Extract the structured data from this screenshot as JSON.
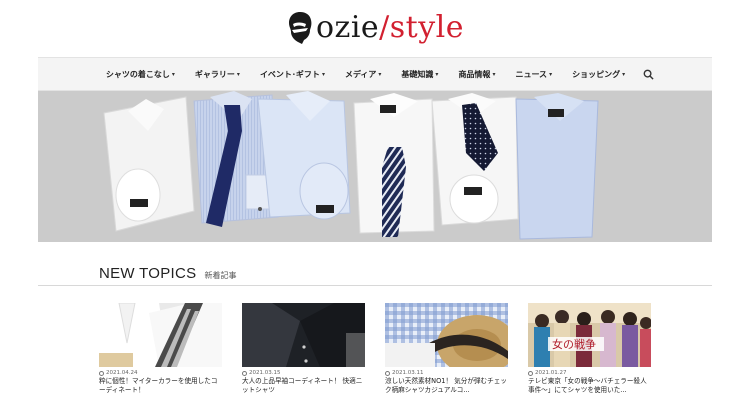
{
  "logo": {
    "part1": "ozie",
    "slash": "/",
    "part2": "style",
    "brand_color": "#d22030"
  },
  "nav": {
    "items": [
      {
        "label": "シャツの着こなし",
        "caret": "▾"
      },
      {
        "label": "ギャラリー",
        "caret": "▾"
      },
      {
        "label": "イベント･ギフト",
        "caret": "▾"
      },
      {
        "label": "メディア",
        "caret": "▾"
      },
      {
        "label": "基礎知識",
        "caret": "▾"
      },
      {
        "label": "商品情報",
        "caret": "▾"
      },
      {
        "label": "ニュース",
        "caret": "▾"
      },
      {
        "label": "ショッピング",
        "caret": "▾"
      }
    ],
    "search_icon": "search-icon"
  },
  "section": {
    "title": "NEW TOPICS",
    "subtitle": "新着記事"
  },
  "topics": [
    {
      "date": "2021.04.24",
      "title": "粋に個性！マイターカラーを使用したコーディネート！"
    },
    {
      "date": "2021.03.15",
      "title": "大人の上品早袖コーディネート！ 快適ニットシャツ"
    },
    {
      "date": "2021.03.11",
      "title": "涼しい天然素材NO1！ 気分が弾むチェック柄麻シャツカジュアルコ..."
    },
    {
      "date": "2021.01.27",
      "title": "テレビ東京「女の戦争～バチェラー殺人事件～」にてシャツを使用いた..."
    }
  ],
  "topic_images": {
    "tv_banner_text": "女の戦争"
  }
}
